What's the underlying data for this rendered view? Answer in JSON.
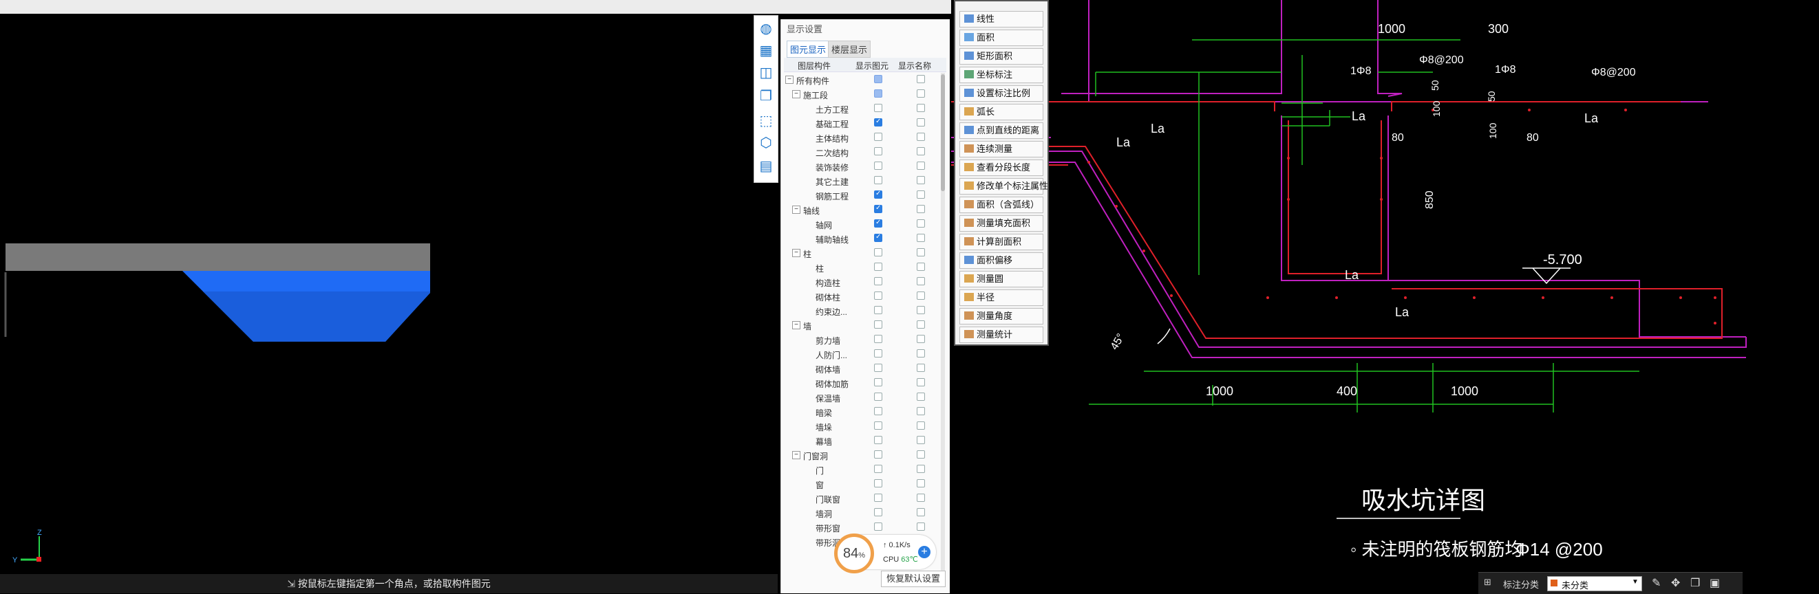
{
  "viewport": {
    "status_text": "按鼠标左键指定第一个角点，或拾取构件图元",
    "axis_z": "Z",
    "axis_y": "Y",
    "colors": {
      "slab_gray": "#7a7a7a",
      "pit_blue": "#1f6bf5",
      "bg": "#000000"
    }
  },
  "vertical_toolbar": {
    "icons": [
      "3d-sphere-icon",
      "grid-view-icon",
      "cube-icon",
      "layer-stack-icon",
      "select-box-icon",
      "component-cube-icon",
      "report-icon"
    ]
  },
  "display_panel": {
    "title": "显示设置",
    "tabs": [
      "图元显示",
      "楼层显示"
    ],
    "columns": [
      "图层构件",
      "显示图元",
      "显示名称"
    ],
    "rows": [
      {
        "label": "所有构件",
        "level": 0,
        "toggle": "⊟",
        "show": "part",
        "name": "off"
      },
      {
        "label": "施工段",
        "level": 1,
        "toggle": "⊟",
        "show": "part",
        "name": "off"
      },
      {
        "label": "土方工程",
        "level": 2,
        "show": "off",
        "name": "off"
      },
      {
        "label": "基础工程",
        "level": 2,
        "show": "on",
        "name": "off"
      },
      {
        "label": "主体结构",
        "level": 2,
        "show": "off",
        "name": "off"
      },
      {
        "label": "二次结构",
        "level": 2,
        "show": "off",
        "name": "off"
      },
      {
        "label": "装饰装修",
        "level": 2,
        "show": "off",
        "name": "off"
      },
      {
        "label": "其它土建",
        "level": 2,
        "show": "off",
        "name": "off"
      },
      {
        "label": "钢筋工程",
        "level": 2,
        "show": "on",
        "name": "off"
      },
      {
        "label": "轴线",
        "level": 1,
        "toggle": "⊟",
        "show": "on",
        "name": "off"
      },
      {
        "label": "轴网",
        "level": 2,
        "show": "on",
        "name": "off"
      },
      {
        "label": "辅助轴线",
        "level": 2,
        "show": "on",
        "name": "off"
      },
      {
        "label": "柱",
        "level": 1,
        "toggle": "⊟",
        "show": "off",
        "name": "off"
      },
      {
        "label": "柱",
        "level": 2,
        "show": "off",
        "name": "off"
      },
      {
        "label": "构造柱",
        "level": 2,
        "show": "off",
        "name": "off"
      },
      {
        "label": "砌体柱",
        "level": 2,
        "show": "off",
        "name": "off"
      },
      {
        "label": "约束边...",
        "level": 2,
        "show": "off",
        "name": "off"
      },
      {
        "label": "墙",
        "level": 1,
        "toggle": "⊟",
        "show": "off",
        "name": "off"
      },
      {
        "label": "剪力墙",
        "level": 2,
        "show": "off",
        "name": "off"
      },
      {
        "label": "人防门...",
        "level": 2,
        "show": "off",
        "name": "off"
      },
      {
        "label": "砌体墙",
        "level": 2,
        "show": "off",
        "name": "off"
      },
      {
        "label": "砌体加筋",
        "level": 2,
        "show": "off",
        "name": "off"
      },
      {
        "label": "保温墙",
        "level": 2,
        "show": "off",
        "name": "off"
      },
      {
        "label": "暗梁",
        "level": 2,
        "show": "off",
        "name": "off"
      },
      {
        "label": "墙垛",
        "level": 2,
        "show": "off",
        "name": "off"
      },
      {
        "label": "幕墙",
        "level": 2,
        "show": "off",
        "name": "off"
      },
      {
        "label": "门窗洞",
        "level": 1,
        "toggle": "⊟",
        "show": "off",
        "name": "off"
      },
      {
        "label": "门",
        "level": 2,
        "show": "off",
        "name": "off"
      },
      {
        "label": "窗",
        "level": 2,
        "show": "off",
        "name": "off"
      },
      {
        "label": "门联窗",
        "level": 2,
        "show": "off",
        "name": "off"
      },
      {
        "label": "墙洞",
        "level": 2,
        "show": "off",
        "name": "off"
      },
      {
        "label": "带形窗",
        "level": 2,
        "show": "off",
        "name": "off"
      },
      {
        "label": "带形洞",
        "level": 2,
        "show": "off",
        "name": "off"
      }
    ],
    "restore_button": "恢复默认设置"
  },
  "monitor": {
    "percent": "84",
    "percent_unit": "%",
    "net": "↑ 0.1K/s",
    "cpu_label": "CPU",
    "cpu_temp": "63℃",
    "plus": "+"
  },
  "measure_toolbar": {
    "items": [
      {
        "label": "线性",
        "icon": "linear-dim-icon"
      },
      {
        "label": "面积",
        "icon": "area-icon"
      },
      {
        "label": "矩形面积",
        "icon": "rect-area-icon"
      },
      {
        "label": "坐标标注",
        "icon": "coordinate-icon"
      },
      {
        "label": "设置标注比例",
        "icon": "scale-icon"
      },
      {
        "label": "弧长",
        "icon": "arc-length-icon"
      },
      {
        "label": "点到直线的距离",
        "icon": "point-line-icon"
      },
      {
        "label": "连续测量",
        "icon": "continuous-measure-icon"
      },
      {
        "label": "查看分段长度",
        "icon": "segment-length-icon"
      },
      {
        "label": "修改单个标注属性",
        "icon": "edit-dim-icon"
      },
      {
        "label": "面积（含弧线）",
        "icon": "arc-area-icon"
      },
      {
        "label": "测量填充面积",
        "icon": "fill-area-icon"
      },
      {
        "label": "计算剖面积",
        "icon": "section-area-icon"
      },
      {
        "label": "面积偏移",
        "icon": "area-offset-icon"
      },
      {
        "label": "测量圆",
        "icon": "circle-measure-icon"
      },
      {
        "label": "半径",
        "icon": "radius-icon"
      },
      {
        "label": "测量角度",
        "icon": "angle-icon"
      },
      {
        "label": "测量统计",
        "icon": "statistics-icon"
      }
    ]
  },
  "cad": {
    "dims_top": [
      "1000",
      "300"
    ],
    "labels": {
      "r1": "1Φ8",
      "r2": "Φ8@200",
      "r3": "1Φ8",
      "r4": "Φ8@200",
      "d50a": "50",
      "d100a": "100",
      "d50b": "50",
      "d100b": "100",
      "d80a": "80",
      "d80b": "80",
      "d850": "850",
      "elev": "-5.700",
      "la1": "La",
      "la2": "La",
      "la3": "La",
      "la4": "La",
      "la5": "La",
      "la6": "La",
      "angle": "45°"
    },
    "dims_bottom": [
      "1000",
      "400",
      "1000"
    ],
    "title": "吸水坑详图",
    "note": "◦ 未注明的筏板钢筋均",
    "note_bar": "Φ14 @200",
    "colors": {
      "concrete": "#c020c0",
      "rebar": "#e0202a",
      "dim": "#20c020",
      "text": "#ffffff"
    }
  },
  "cad_status": {
    "label": "标注分类",
    "category": "未分类"
  }
}
